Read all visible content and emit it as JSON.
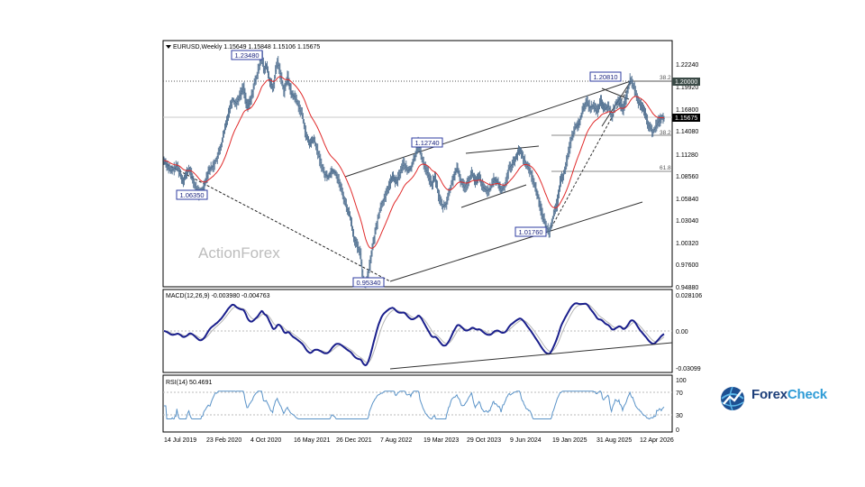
{
  "chart_data": [
    {
      "type": "line",
      "panel": "main",
      "header": "EURUSD,Weekly  1.15649 1.15848 1.15106 1.15675",
      "x_tick_labels": [
        "14 Jul 2019",
        "23 Feb 2020",
        "4 Oct 2020",
        "16 May 2021",
        "26 Dec 2021",
        "7 Aug 2022",
        "19 Mar 2023",
        "29 Oct 2023",
        "9 Jun 2024",
        "19 Jan 2025",
        "31 Aug 2025",
        "12 Apr 2026"
      ],
      "y_tick_labels": [
        "1.22240",
        "1.19920",
        "1.16800",
        "1.14080",
        "1.11280",
        "1.08560",
        "1.05840",
        "1.03040",
        "1.00320",
        "0.97600",
        "0.94880"
      ],
      "ylim": [
        0.9488,
        1.2344
      ],
      "price_label": "1.15675",
      "level_label": "1.20000",
      "annotations": [
        "1.23480",
        "1.06350",
        "0.95340",
        "1.12740",
        "1.01760",
        "1.20810"
      ],
      "fib_labels": [
        "38.2",
        "38.2",
        "61.8"
      ],
      "watermark": "ActionForex",
      "anchors": [
        [
          0,
          1.105
        ],
        [
          7,
          1.092
        ],
        [
          14,
          1.098
        ],
        [
          20,
          1.08
        ],
        [
          27,
          1.095
        ],
        [
          33,
          1.075
        ],
        [
          38,
          1.063
        ],
        [
          42,
          1.07
        ],
        [
          48,
          1.093
        ],
        [
          53,
          1.098
        ],
        [
          58,
          1.11
        ],
        [
          62,
          1.125
        ],
        [
          66,
          1.145
        ],
        [
          70,
          1.165
        ],
        [
          74,
          1.18
        ],
        [
          78,
          1.175
        ],
        [
          82,
          1.185
        ],
        [
          86,
          1.195
        ],
        [
          90,
          1.17
        ],
        [
          94,
          1.18
        ],
        [
          98,
          1.2
        ],
        [
          101,
          1.21
        ],
        [
          104,
          1.228
        ],
        [
          106,
          1.234
        ],
        [
          108,
          1.215
        ],
        [
          111,
          1.222
        ],
        [
          114,
          1.205
        ],
        [
          118,
          1.192
        ],
        [
          121,
          1.215
        ],
        [
          123,
          1.227
        ],
        [
          126,
          1.212
        ],
        [
          130,
          1.19
        ],
        [
          134,
          1.208
        ],
        [
          138,
          1.187
        ],
        [
          142,
          1.183
        ],
        [
          146,
          1.172
        ],
        [
          150,
          1.16
        ],
        [
          154,
          1.135
        ],
        [
          158,
          1.125
        ],
        [
          162,
          1.132
        ],
        [
          166,
          1.118
        ],
        [
          170,
          1.102
        ],
        [
          174,
          1.088
        ],
        [
          178,
          1.085
        ],
        [
          182,
          1.093
        ],
        [
          186,
          1.09
        ],
        [
          190,
          1.078
        ],
        [
          194,
          1.062
        ],
        [
          198,
          1.048
        ],
        [
          202,
          1.035
        ],
        [
          206,
          1.01
        ],
        [
          210,
          0.998
        ],
        [
          213,
          0.99
        ],
        [
          216,
          0.958
        ],
        [
          219,
          0.953
        ],
        [
          222,
          0.97
        ],
        [
          224,
          0.985
        ],
        [
          228,
          1.01
        ],
        [
          232,
          1.035
        ],
        [
          236,
          1.052
        ],
        [
          240,
          1.06
        ],
        [
          244,
          1.075
        ],
        [
          248,
          1.085
        ],
        [
          252,
          1.078
        ],
        [
          256,
          1.09
        ],
        [
          260,
          1.102
        ],
        [
          264,
          1.092
        ],
        [
          268,
          1.096
        ],
        [
          272,
          1.11
        ],
        [
          276,
          1.127
        ],
        [
          278,
          1.115
        ],
        [
          282,
          1.1
        ],
        [
          286,
          1.09
        ],
        [
          290,
          1.075
        ],
        [
          294,
          1.085
        ],
        [
          298,
          1.062
        ],
        [
          302,
          1.048
        ],
        [
          306,
          1.052
        ],
        [
          310,
          1.068
        ],
        [
          314,
          1.085
        ],
        [
          318,
          1.095
        ],
        [
          322,
          1.08
        ],
        [
          326,
          1.072
        ],
        [
          330,
          1.08
        ],
        [
          334,
          1.09
        ],
        [
          338,
          1.078
        ],
        [
          342,
          1.085
        ],
        [
          346,
          1.072
        ],
        [
          350,
          1.068
        ],
        [
          354,
          1.07
        ],
        [
          358,
          1.082
        ],
        [
          362,
          1.078
        ],
        [
          366,
          1.068
        ],
        [
          370,
          1.075
        ],
        [
          374,
          1.095
        ],
        [
          378,
          1.1
        ],
        [
          382,
          1.11
        ],
        [
          386,
          1.118
        ],
        [
          390,
          1.108
        ],
        [
          394,
          1.098
        ],
        [
          398,
          1.09
        ],
        [
          402,
          1.075
        ],
        [
          406,
          1.06
        ],
        [
          410,
          1.04
        ],
        [
          414,
          1.025
        ],
        [
          418,
          1.018
        ],
        [
          422,
          1.035
        ],
        [
          426,
          1.05
        ],
        [
          430,
          1.078
        ],
        [
          434,
          1.09
        ],
        [
          438,
          1.11
        ],
        [
          442,
          1.132
        ],
        [
          446,
          1.145
        ],
        [
          450,
          1.15
        ],
        [
          454,
          1.165
        ],
        [
          458,
          1.178
        ],
        [
          462,
          1.17
        ],
        [
          466,
          1.172
        ],
        [
          470,
          1.165
        ],
        [
          474,
          1.178
        ],
        [
          478,
          1.168
        ],
        [
          482,
          1.172
        ],
        [
          486,
          1.158
        ],
        [
          490,
          1.175
        ],
        [
          494,
          1.18
        ],
        [
          498,
          1.165
        ],
        [
          502,
          1.185
        ],
        [
          506,
          1.205
        ],
        [
          510,
          1.195
        ],
        [
          514,
          1.178
        ],
        [
          518,
          1.172
        ],
        [
          522,
          1.162
        ],
        [
          526,
          1.148
        ],
        [
          530,
          1.14
        ],
        [
          533,
          1.145
        ],
        [
          536,
          1.152
        ],
        [
          540,
          1.158
        ],
        [
          543,
          1.1567
        ]
      ]
    },
    {
      "type": "line",
      "panel": "macd",
      "header": "MACD(12,26,9) -0.003980 -0.004763",
      "y_tick_labels": [
        "0.028106",
        "0.00",
        "-0.03099"
      ]
    },
    {
      "type": "line",
      "panel": "rsi",
      "header": "RSI(14) 50.4691",
      "y_tick_labels": [
        "100",
        "70",
        "30",
        "0"
      ]
    }
  ],
  "branding": {
    "logo_text_a": "Forex",
    "logo_text_b": "Check"
  },
  "colors": {
    "bar": "#4d6d8e",
    "ma": "#e02a2a",
    "macd": "#1a1f8c",
    "signal": "#b5b5b5",
    "rsi": "#5a93c8",
    "label_border": "#2f3da0",
    "level_box": "#3a4a46",
    "price_box": "#000000"
  }
}
